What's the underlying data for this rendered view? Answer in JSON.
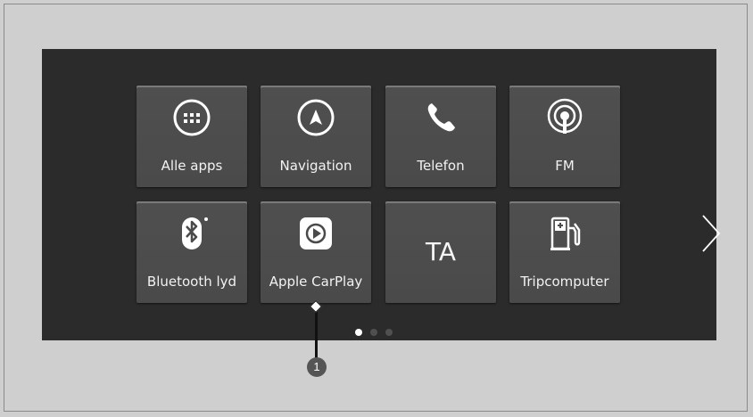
{
  "tiles": [
    {
      "label": "Alle apps",
      "icon": "apps-grid-icon"
    },
    {
      "label": "Navigation",
      "icon": "navigation-icon"
    },
    {
      "label": "Telefon",
      "icon": "phone-icon"
    },
    {
      "label": "FM",
      "icon": "radio-icon"
    },
    {
      "label": "Bluetooth lyd",
      "icon": "bluetooth-icon"
    },
    {
      "label": "Apple CarPlay",
      "icon": "carplay-icon"
    },
    {
      "label": "TA",
      "icon": "none"
    },
    {
      "label": "Tripcomputer",
      "icon": "fuel-pump-icon"
    }
  ],
  "pagination": {
    "pages": 3,
    "current": 1
  },
  "callout": {
    "number": "1"
  }
}
